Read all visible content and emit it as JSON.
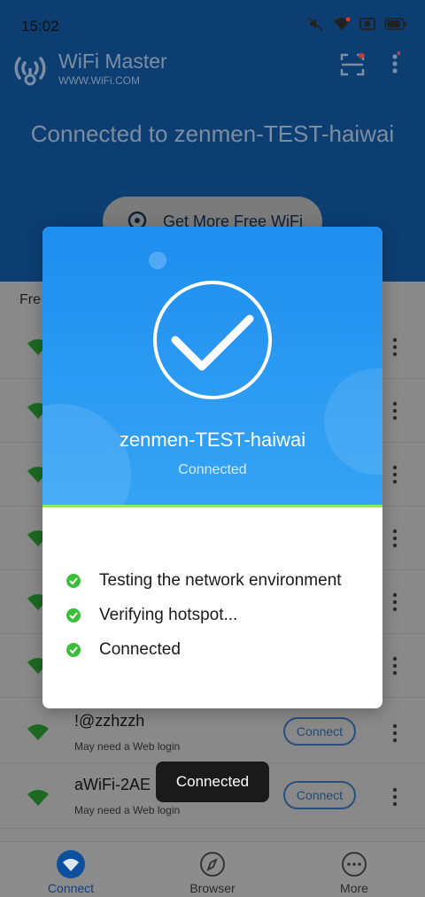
{
  "status_bar": {
    "time": "15:02"
  },
  "app": {
    "name": "WiFi Master",
    "url": "WWW.WiFi.COM",
    "connected_title": "Connected to zenmen-TEST-haiwai",
    "free_wifi_button": "Get More Free WiFi",
    "list_header": "Fre",
    "list_rows": [
      {
        "ssid": "",
        "sub": ""
      },
      {
        "ssid": "",
        "sub": ""
      },
      {
        "ssid": "",
        "sub": ""
      },
      {
        "ssid": "",
        "sub": ""
      },
      {
        "ssid": "",
        "sub": ""
      },
      {
        "ssid": "",
        "sub": ""
      },
      {
        "ssid": "!@zzhzzh",
        "sub": "May need a Web login",
        "button": "Connect"
      },
      {
        "ssid": "aWiFi-2AE",
        "sub": "May need a Web login",
        "button": "Connect"
      }
    ],
    "bottom_nav": [
      {
        "label": "Connect",
        "icon": "wifi-icon",
        "active": true
      },
      {
        "label": "Browser",
        "icon": "compass-icon",
        "active": false
      },
      {
        "label": "More",
        "icon": "more-icon",
        "active": false
      }
    ]
  },
  "dialog": {
    "ssid": "zenmen-TEST-haiwai",
    "state": "Connected",
    "steps": [
      "Testing the network environment",
      "Verifying hotspot...",
      "Connected"
    ]
  },
  "toast": "Connected",
  "colors": {
    "accent": "#1e8ef0",
    "success": "#3bbf3b",
    "header_dim": "#0d3e72"
  }
}
